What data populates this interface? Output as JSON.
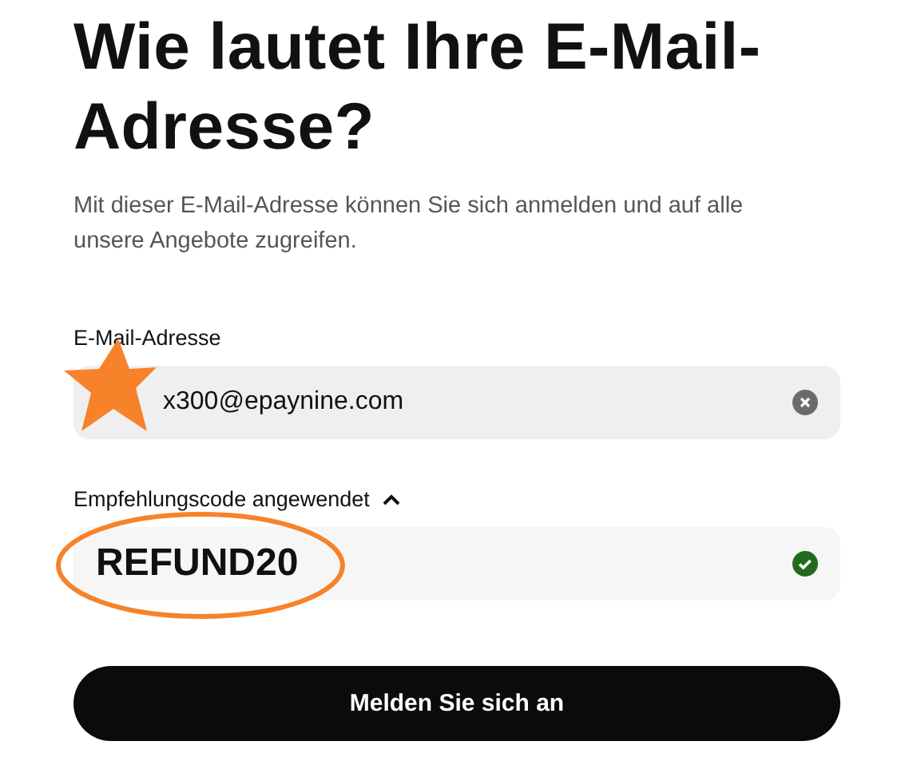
{
  "heading": "Wie lautet Ihre E-Mail-Adresse?",
  "subtitle": "Mit dieser E-Mail-Adresse können Sie sich anmelden und auf alle unsere Angebote zugreifen.",
  "email_field": {
    "label": "E-Mail-Adresse",
    "value": "x300@epaynine.com"
  },
  "referral": {
    "label": "Empfehlungscode angewendet",
    "expanded": true,
    "value": "REFUND20",
    "valid": true
  },
  "submit_button": "Melden Sie sich an"
}
